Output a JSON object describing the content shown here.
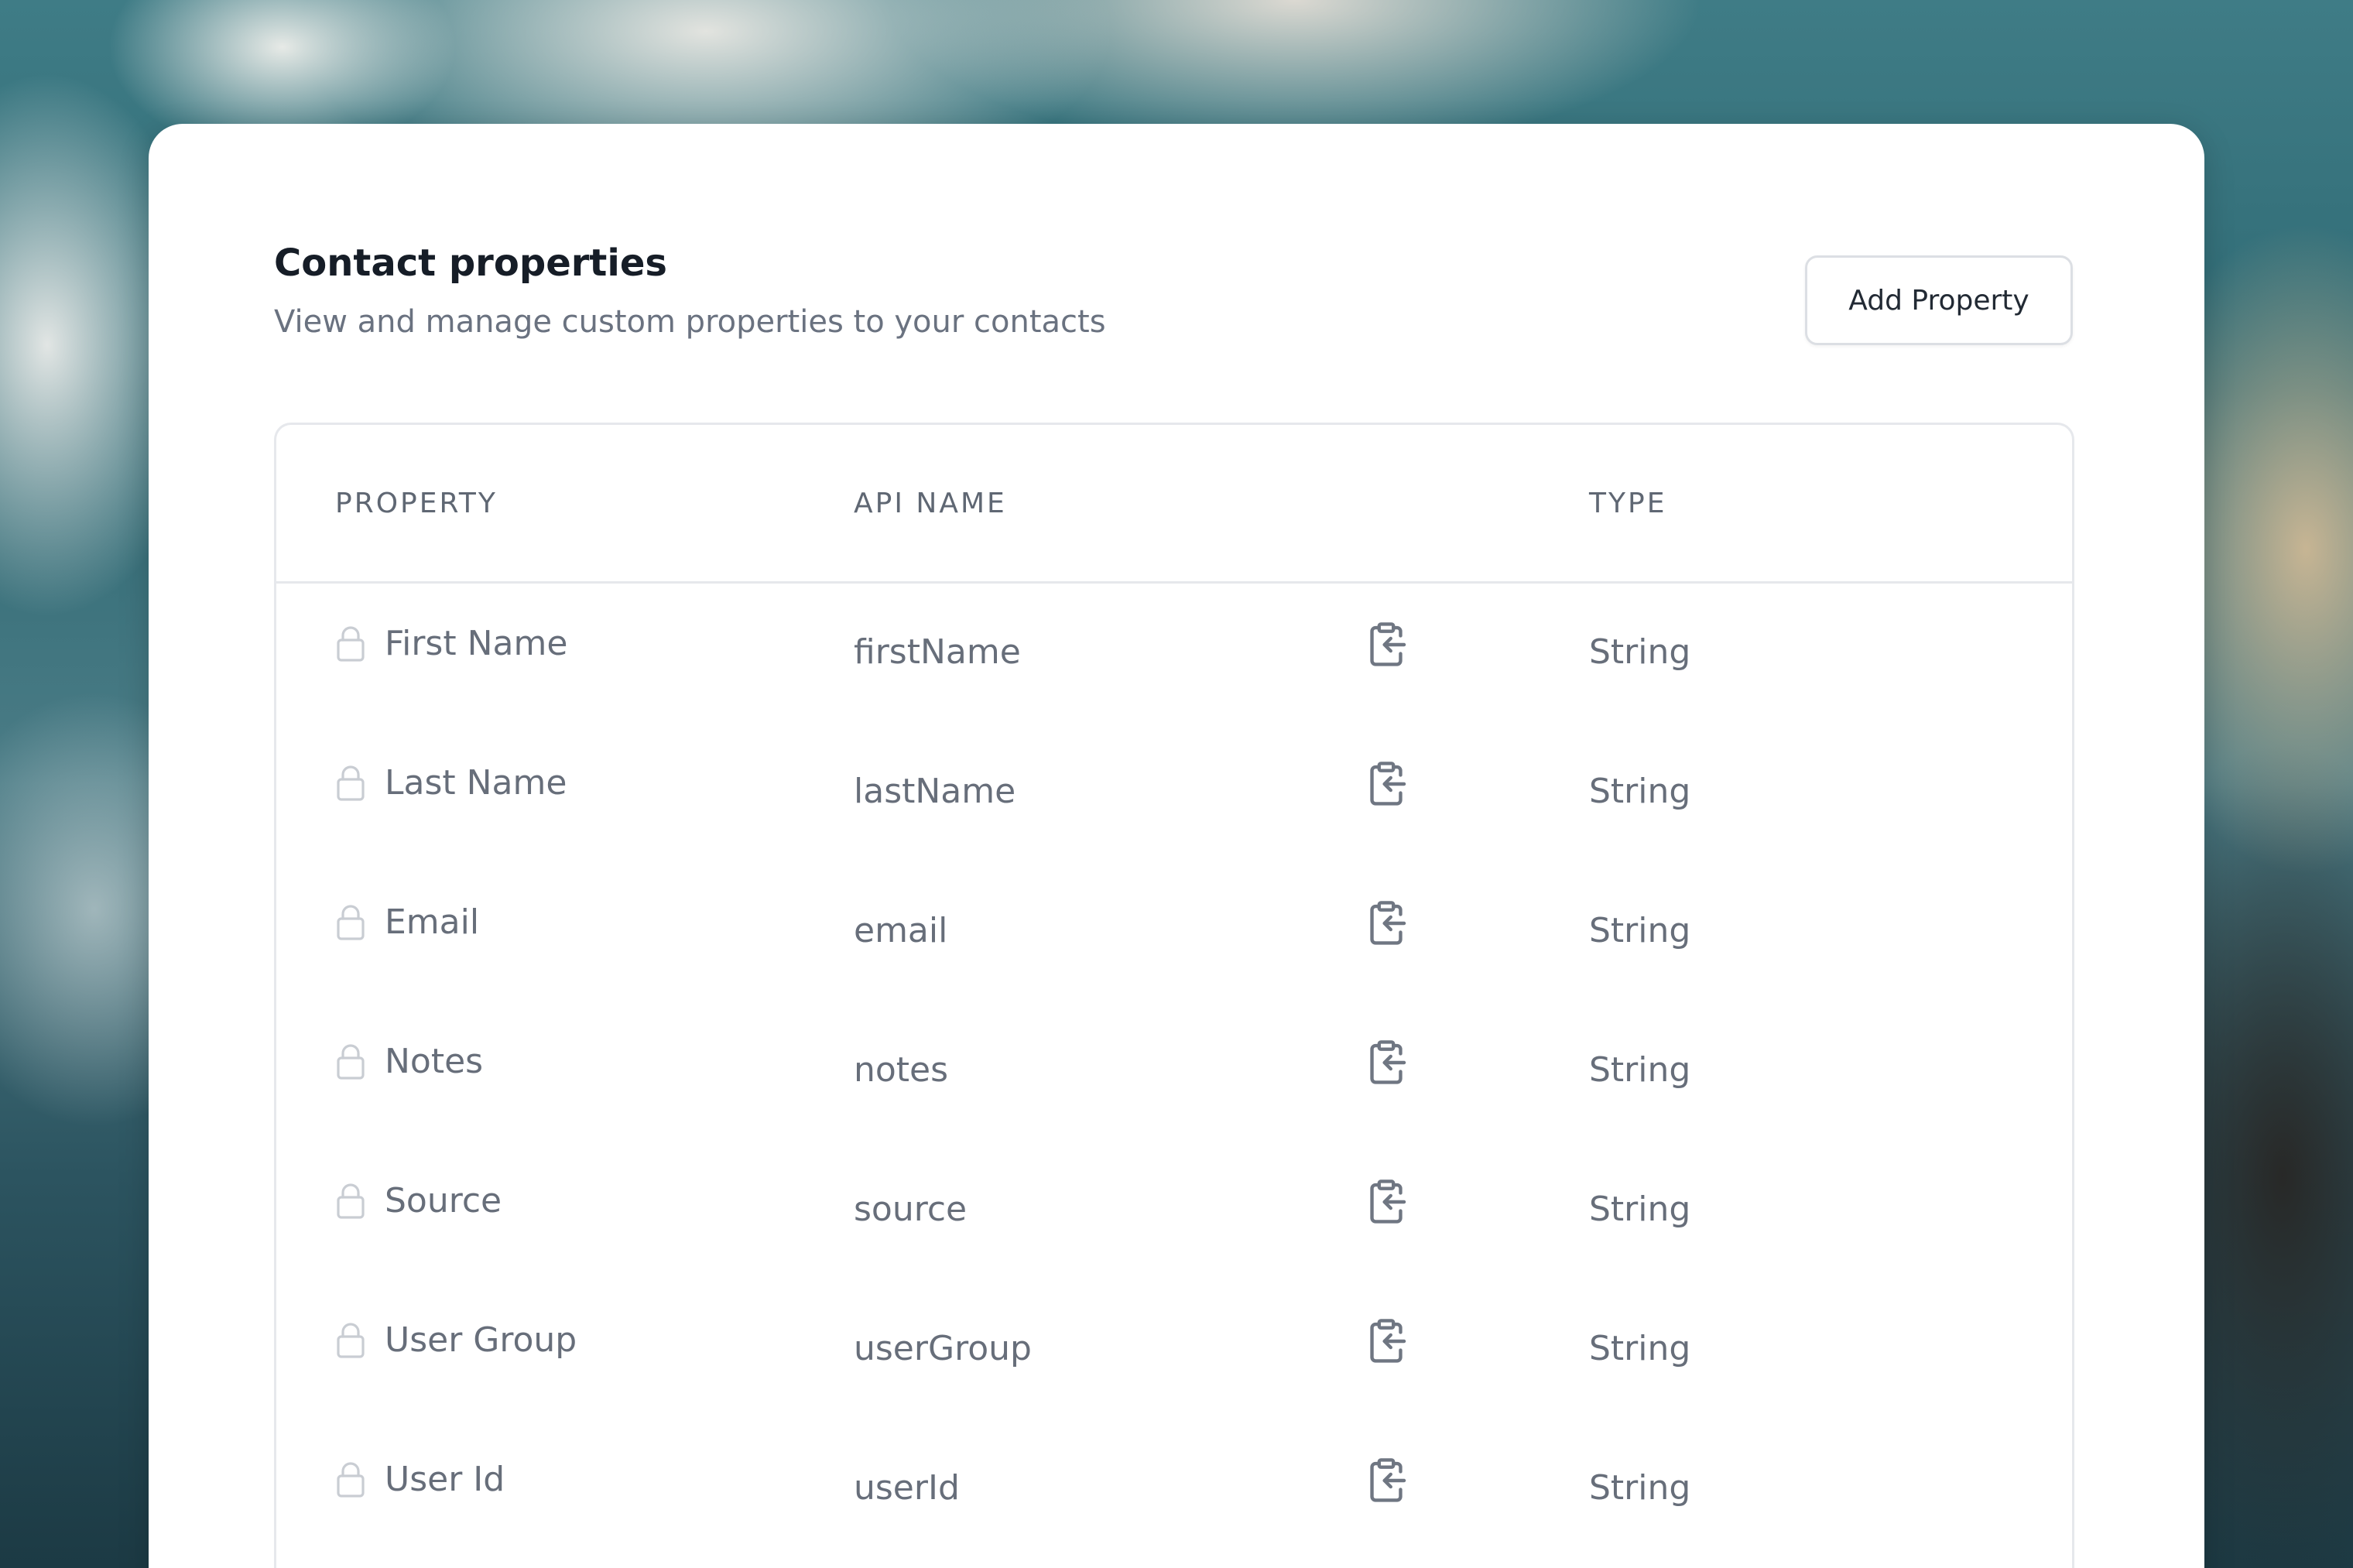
{
  "header": {
    "title": "Contact properties",
    "subtitle": "View and manage custom properties to your contacts",
    "add_button_label": "Add Property"
  },
  "table": {
    "columns": {
      "property": "PROPERTY",
      "api_name": "API NAME",
      "type": "TYPE"
    },
    "rows": [
      {
        "property": "First Name",
        "api_name": "firstName",
        "type": "String",
        "locked": true
      },
      {
        "property": "Last Name",
        "api_name": "lastName",
        "type": "String",
        "locked": true
      },
      {
        "property": "Email",
        "api_name": "email",
        "type": "String",
        "locked": true
      },
      {
        "property": "Notes",
        "api_name": "notes",
        "type": "String",
        "locked": true
      },
      {
        "property": "Source",
        "api_name": "source",
        "type": "String",
        "locked": true
      },
      {
        "property": "User Group",
        "api_name": "userGroup",
        "type": "String",
        "locked": true
      },
      {
        "property": "User Id",
        "api_name": "userId",
        "type": "String",
        "locked": true
      }
    ]
  },
  "icons": {
    "row_status": "lock-icon",
    "row_action": "clipboard-copy-icon"
  },
  "colors": {
    "title": "#161d27",
    "muted_text": "#676e7a",
    "border": "#e6e8ec",
    "card": "#ffffff"
  }
}
